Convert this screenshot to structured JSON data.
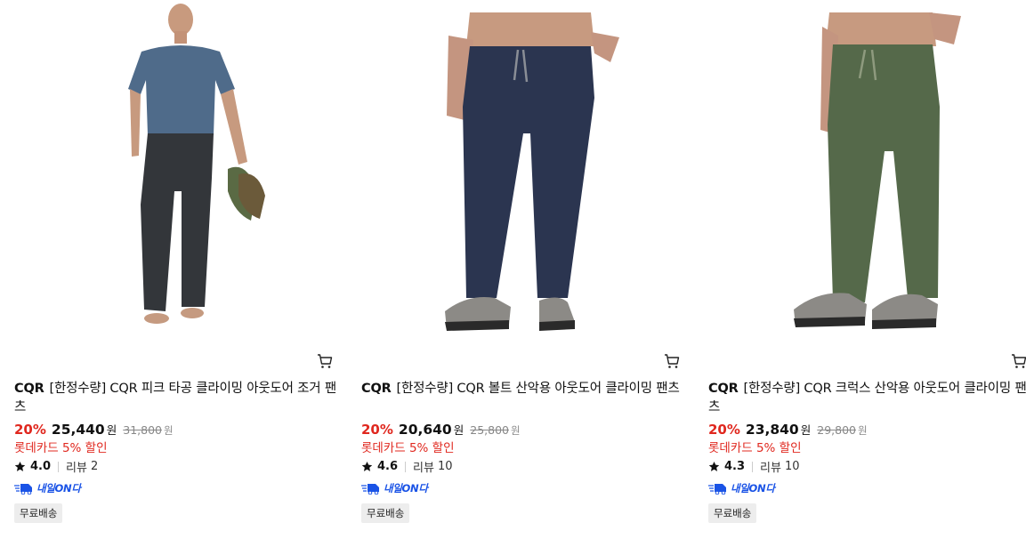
{
  "products": [
    {
      "brand": "CQR",
      "name": "[한정수량] CQR 피크 타공 클라이밍 아웃도어 조거 팬츠",
      "discount": "20%",
      "price": "25,440",
      "currency": "원",
      "original_price": "31,800",
      "card_discount": "롯데카드 5% 할인",
      "rating": "4.0",
      "review_label": "리뷰",
      "review_count": "2",
      "delivery_badge": "내일ON다",
      "shipping_tag": "무료배송",
      "image": "man-grey-tshirt-dark-charcoal-jogger-pants-holding-shoes",
      "pants_color": "#33363a"
    },
    {
      "brand": "CQR",
      "name": "[한정수량] CQR 볼트 산악용 아웃도어 클라이밍 팬츠",
      "discount": "20%",
      "price": "20,640",
      "currency": "원",
      "original_price": "25,800",
      "card_discount": "롯데카드 5% 할인",
      "rating": "4.6",
      "review_label": "리뷰",
      "review_count": "10",
      "delivery_badge": "내일ON다",
      "shipping_tag": "무료배송",
      "image": "navy-climbing-pants-with-grey-hiking-shoes",
      "pants_color": "#2b3550"
    },
    {
      "brand": "CQR",
      "name": "[한정수량] CQR 크럭스 산악용 아웃도어 클라이밍 팬츠",
      "discount": "20%",
      "price": "23,840",
      "currency": "원",
      "original_price": "29,800",
      "card_discount": "롯데카드 5% 할인",
      "rating": "4.3",
      "review_label": "리뷰",
      "review_count": "10",
      "delivery_badge": "내일ON다",
      "shipping_tag": "무료배송",
      "image": "olive-green-climbing-pants-with-grey-hiking-shoes",
      "pants_color": "#55694a"
    }
  ],
  "icons": {
    "cart": "cart-icon",
    "star": "star-icon",
    "delivery": "delivery-truck-icon"
  },
  "colors": {
    "discount_red": "#e0281f",
    "delivery_blue": "#1a53e6",
    "tag_bg": "#ededed"
  }
}
